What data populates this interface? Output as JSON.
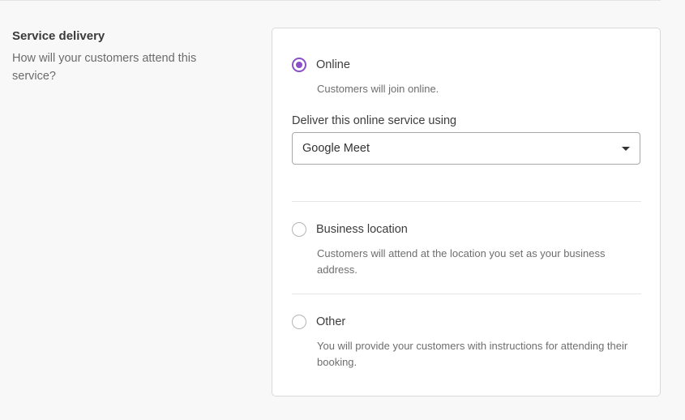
{
  "section": {
    "title": "Service delivery",
    "description": "How will your customers attend this service?"
  },
  "accent_color": "#8a4fc9",
  "options": [
    {
      "label": "Online",
      "description": "Customers will join online.",
      "selected": true
    },
    {
      "label": "Business location",
      "description": "Customers will attend at the location you set as your business address.",
      "selected": false
    },
    {
      "label": "Other",
      "description": "You will provide your customers with instructions for attending their booking.",
      "selected": false
    }
  ],
  "online_service": {
    "label": "Deliver this online service using",
    "selected_value": "Google Meet",
    "caret_icon": "caret-down-icon"
  }
}
